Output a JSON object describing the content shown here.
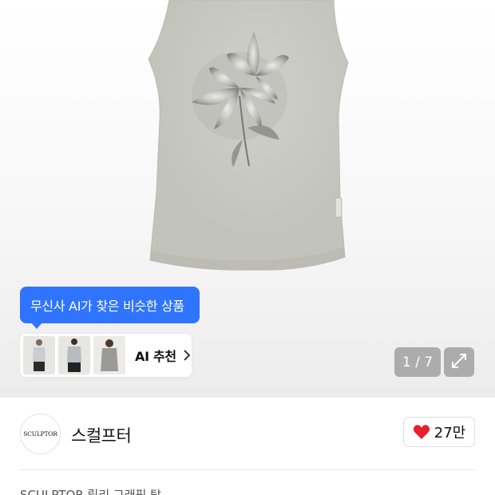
{
  "gallery": {
    "ai_tooltip": "무신사 AI가 찾은 비슷한 상품",
    "ai_recommend_label": "AI 추천",
    "counter": "1 / 7"
  },
  "brand": {
    "logo_text": "SCULPTOR",
    "name": "스컬프터",
    "likes": "27만"
  },
  "product": {
    "title_partial": "SCULPTOR 릴리 그래픽 탑"
  },
  "colors": {
    "accent_blue": "#2f74ff",
    "heart_red": "#e8202e"
  },
  "icons": {
    "chevron": "chevron-right-icon",
    "expand": "expand-icon",
    "heart": "heart-icon"
  }
}
